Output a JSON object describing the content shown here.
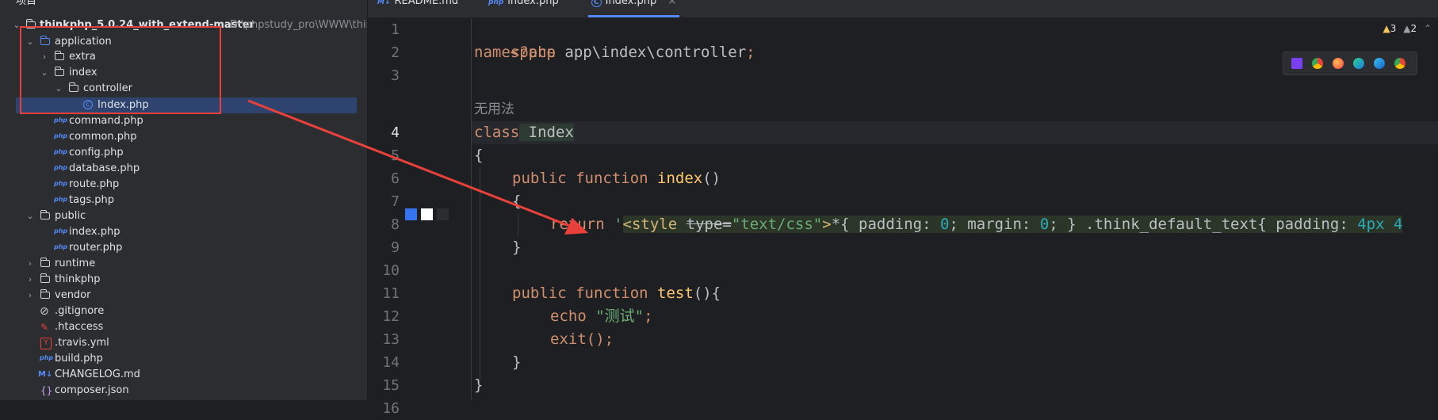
{
  "project_panel": {
    "title": "项目",
    "title_chevron": "⌄",
    "tree": [
      {
        "label": "thinkphp_5.0.24_with_extend-master",
        "path": "D:\\phpstudy_pro\\WWW\\thin",
        "icon": "folder-icon"
      },
      {
        "label": "application",
        "icon": "folder-icon"
      },
      {
        "label": "extra",
        "icon": "folder-icon"
      },
      {
        "label": "index",
        "icon": "folder-icon"
      },
      {
        "label": "controller",
        "icon": "folder-icon"
      },
      {
        "label": "Index.php",
        "icon": "php-class-icon"
      },
      {
        "label": "command.php",
        "icon": "php-file-icon"
      },
      {
        "label": "common.php",
        "icon": "php-file-icon"
      },
      {
        "label": "config.php",
        "icon": "php-file-icon"
      },
      {
        "label": "database.php",
        "icon": "php-file-icon"
      },
      {
        "label": "route.php",
        "icon": "php-file-icon"
      },
      {
        "label": "tags.php",
        "icon": "php-file-icon"
      },
      {
        "label": "public",
        "icon": "folder-icon"
      },
      {
        "label": "index.php",
        "icon": "php-file-icon"
      },
      {
        "label": "router.php",
        "icon": "php-file-icon"
      },
      {
        "label": "runtime",
        "icon": "folder-icon"
      },
      {
        "label": "thinkphp",
        "icon": "folder-icon"
      },
      {
        "label": "vendor",
        "icon": "folder-icon"
      },
      {
        "label": ".gitignore",
        "icon": "ignore-icon"
      },
      {
        "label": ".htaccess",
        "icon": "htaccess-icon"
      },
      {
        "label": ".travis.yml",
        "icon": "yaml-icon"
      },
      {
        "label": "build.php",
        "icon": "php-file-icon"
      },
      {
        "label": "CHANGELOG.md",
        "icon": "markdown-icon"
      },
      {
        "label": "composer.json",
        "icon": "json-icon"
      }
    ],
    "php_badge": "php",
    "class_badge": "C",
    "md_badge": "M↓",
    "yml_badge": "Y",
    "json_badge": "{}"
  },
  "tabs": [
    {
      "label": "README.md",
      "icon": "M↓"
    },
    {
      "label": "index.php",
      "icon": "php"
    },
    {
      "label": "Index.php",
      "icon": "C",
      "close": "×"
    }
  ],
  "editor": {
    "line_numbers": [
      "1",
      "2",
      "3",
      "4",
      "5",
      "6",
      "7",
      "8",
      "9",
      "10",
      "11",
      "12",
      "13",
      "14",
      "15",
      "16"
    ],
    "lines": {
      "l1": "<?php",
      "l2_kw": "namespace",
      "l2_ns": " app\\index\\controller",
      "l2_end": ";",
      "hint": "无用法",
      "l4_kw": "class",
      "l4_cls": " Index",
      "l5": "{",
      "l6_kw": "public function",
      "l6_fn": " index",
      "l6_end": "()",
      "l7": "{",
      "l8_kw": "return",
      "l8_q": " '",
      "l8_tag": "<style",
      "l8_attr": "type",
      "l8_eq": "=",
      "l8_val": "\"text/css\"",
      "l8_close": ">",
      "l8_css1": "*{ padding: ",
      "l8_n1": "0",
      "l8_css2": "; margin: ",
      "l8_n2": "0",
      "l8_css3": "; } .think_default_text{ padding: ",
      "l8_n3": "4px 4",
      "l9": "}",
      "l11_kw": "public function",
      "l11_fn": " test",
      "l11_end": "(){",
      "l12_kw": "echo",
      "l12_str": " \"测试\"",
      "l12_end": ";",
      "l13_fn": "exit",
      "l13_end": "();",
      "l14": "}",
      "l15": "}"
    },
    "warnings": {
      "warn_count": "3",
      "weak_count": "2",
      "warn_icon": "▲",
      "weak_icon": "▲",
      "chevron": "⌃"
    }
  },
  "colors": {
    "accent": "#548af7",
    "highlight_red": "#e8413c",
    "selected_row": "#2e436e"
  }
}
